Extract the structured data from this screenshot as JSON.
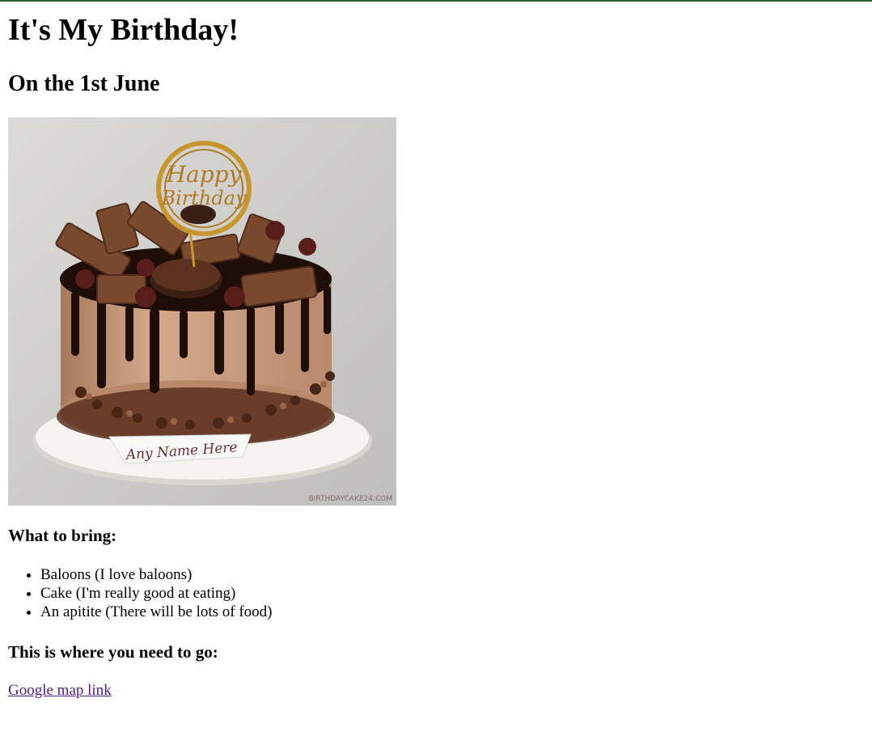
{
  "page": {
    "title": "It's My Birthday!",
    "date_heading": "On the 1st June",
    "cake_image": {
      "topper_text_1": "Happy",
      "topper_text_2": "Birthday",
      "ribbon_text": "Any Name Here",
      "watermark": "BIRTHDAYCAKE24.COM",
      "colors": {
        "background": "#c9c8c6",
        "frosting": "#c69a7a",
        "chocolate": "#2a1410",
        "board": "#f2f2ee",
        "gold": "#c8962e"
      }
    },
    "bring_heading": "What to bring:",
    "bring_items": [
      "Baloons (I love baloons)",
      "Cake (I'm really good at eating)",
      "An apitite (There will be lots of food)"
    ],
    "go_heading": "This is where you need to go:",
    "map_link_text": "Google map link"
  }
}
